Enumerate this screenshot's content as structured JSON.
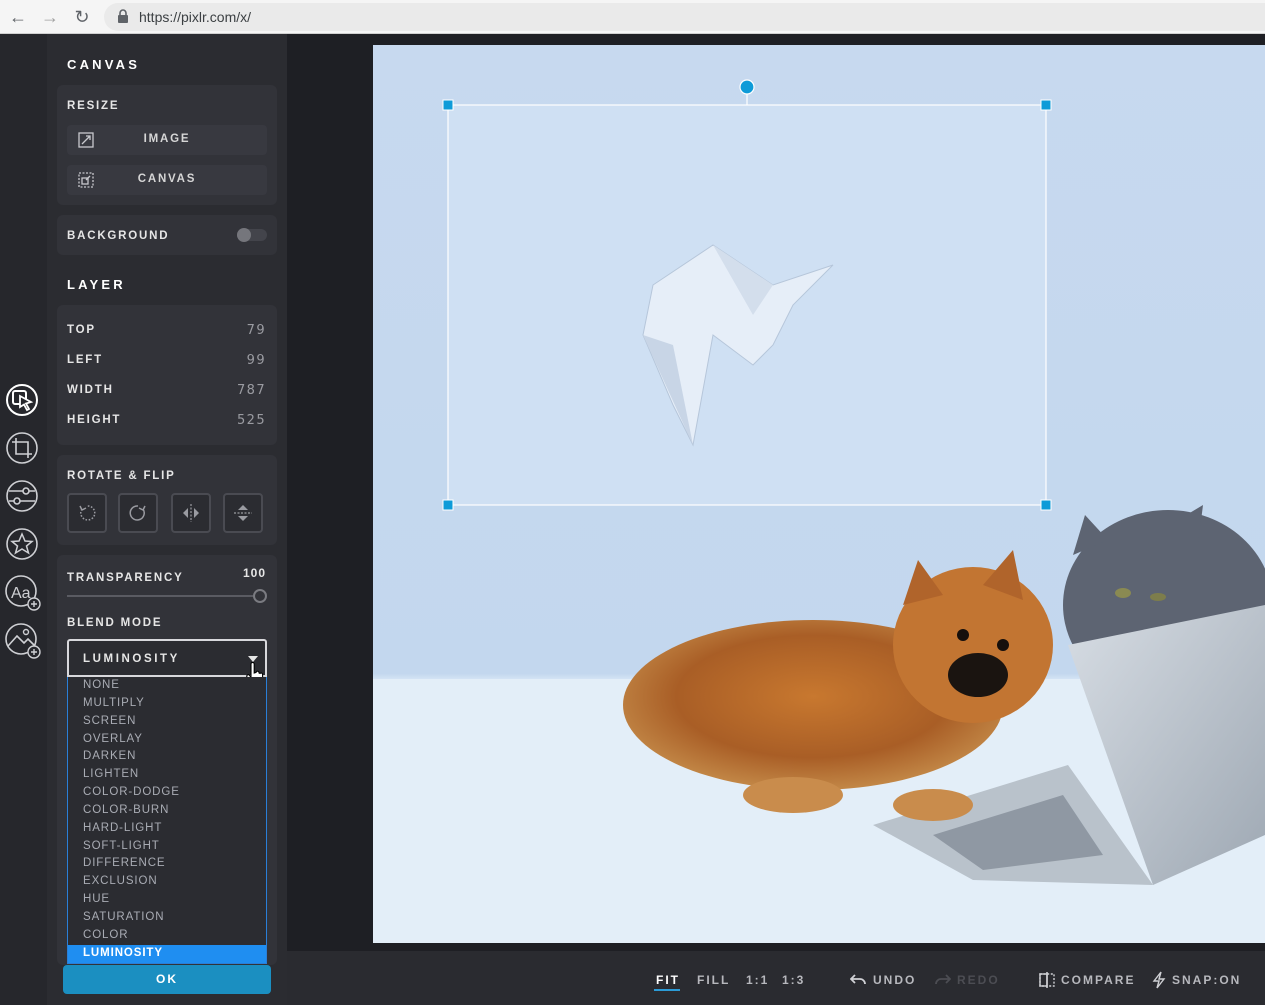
{
  "browser": {
    "url": "https://pixlr.com/x/"
  },
  "panel": {
    "canvas_title": "CANVAS",
    "resize_label": "RESIZE",
    "image_button": "IMAGE",
    "canvas_button": "CANVAS",
    "background_label": "BACKGROUND",
    "background_on": false,
    "layer_title": "LAYER",
    "props": [
      {
        "key": "TOP",
        "value": "79"
      },
      {
        "key": "LEFT",
        "value": "99"
      },
      {
        "key": "WIDTH",
        "value": "787"
      },
      {
        "key": "HEIGHT",
        "value": "525"
      }
    ],
    "rotate_label": "ROTATE & FLIP",
    "transparency_label": "TRANSPARENCY",
    "transparency_value": "100",
    "blend_label": "BLEND MODE",
    "blend_selected": "LUMINOSITY",
    "blend_options": [
      "NONE",
      "MULTIPLY",
      "SCREEN",
      "OVERLAY",
      "DARKEN",
      "LIGHTEN",
      "COLOR-DODGE",
      "COLOR-BURN",
      "HARD-LIGHT",
      "SOFT-LIGHT",
      "DIFFERENCE",
      "EXCLUSION",
      "HUE",
      "SATURATION",
      "COLOR",
      "LUMINOSITY"
    ],
    "ok_label": "OK"
  },
  "tools": [
    "arrange-icon",
    "crop-icon",
    "adjust-icon",
    "effects-icon",
    "add-text-icon",
    "add-image-icon"
  ],
  "bottom": {
    "fit": "FIT",
    "fill": "FILL",
    "one_to_one": "1:1",
    "one_to_three": "1:3",
    "undo": "UNDO",
    "redo": "REDO",
    "compare": "COMPARE",
    "snap": "SNAP:ON"
  },
  "colors": {
    "accent": "#1f8ef1",
    "ok": "#1b8fc1",
    "handle": "#0e9bd8"
  }
}
